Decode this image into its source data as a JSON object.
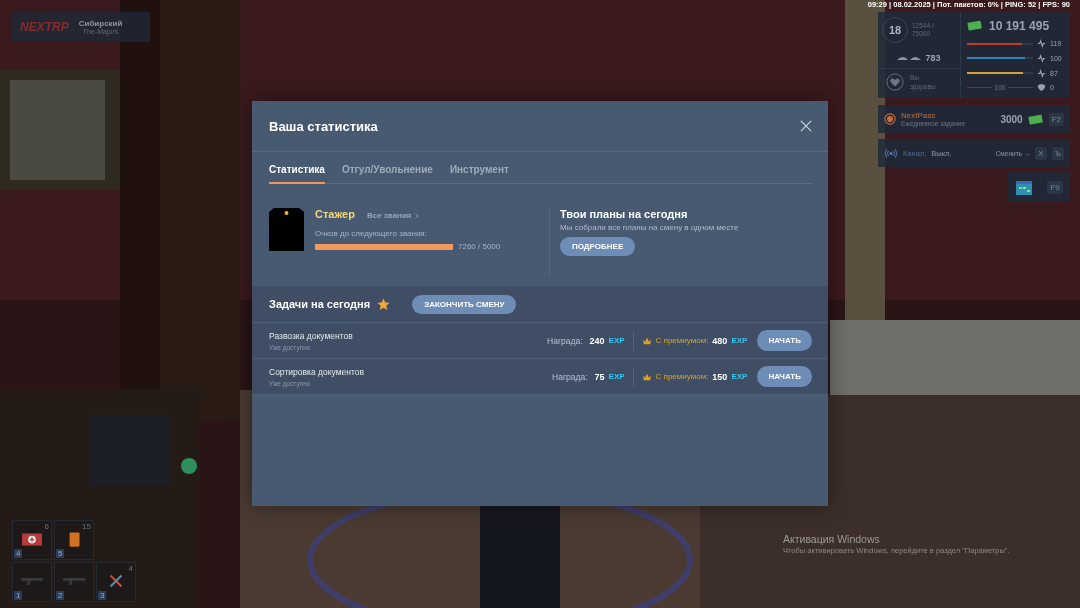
{
  "status_line": "09:29 | 08.02.2025 | Пот. пакетов: 0% | PING: 52 | FPS: 90",
  "server_badge": {
    "logo": "NEXTRP",
    "server": "Сибирский",
    "team": "The-Majors"
  },
  "player_panel": {
    "player_level": "18",
    "xp": "12544 / 75000",
    "money": "10 191 495",
    "reputation": "783",
    "health_status": "Вы здоровы",
    "bars": [
      {
        "kind": "bar",
        "value": "119",
        "color": "#c0392b",
        "level": 0.84
      },
      {
        "kind": "bar",
        "value": "100",
        "color": "#2e86c1",
        "level": 0.88
      },
      {
        "kind": "bar",
        "value": "87",
        "color": "#d4a03a",
        "level": 0.85
      },
      {
        "kind": "split",
        "value": "0",
        "center": "100"
      }
    ]
  },
  "nextpass": {
    "title": "NextPass",
    "subtitle": "Ежедневное задание",
    "reward": "3000",
    "key": "F2"
  },
  "radio": {
    "label": "Канал:",
    "value": "Выкл.",
    "action": "Сменить →",
    "keys": [
      "X",
      "Ъ"
    ]
  },
  "calendar": {
    "key": "F9"
  },
  "modal": {
    "title": "Ваша статистика",
    "tabs": [
      {
        "label": "Статистика",
        "selected": true
      },
      {
        "label": "Отгул/Увольнение",
        "selected": false
      },
      {
        "label": "Инструмент",
        "selected": false
      }
    ],
    "rank": {
      "name": "Стажер",
      "link": "Все звания",
      "progress_label": "Очков до следующего звания:",
      "level": 1,
      "reading": "7260 / 5000"
    },
    "plans": {
      "title": "Твои планы на сегодня",
      "text": "Мы собрали все планы на смену в одном месте",
      "button": "ПОДРОБНЕЕ"
    },
    "tasks": {
      "title": "Задачи на сегодня",
      "finish_button": "ЗАКОНЧИТЬ СМЕНУ",
      "rows": [
        {
          "name": "Развозка документов",
          "status": "Уже доступно",
          "reward_label": "Награда:",
          "reward": "240",
          "reward_unit": "EXP",
          "premium_label": "С премиумом:",
          "premium": "480",
          "premium_unit": "EXP",
          "button": "НАЧАТЬ"
        },
        {
          "name": "Сортировка документов",
          "status": "Уже доступно",
          "reward_label": "Награда:",
          "reward": "75",
          "reward_unit": "EXP",
          "premium_label": "С премиумом:",
          "premium": "150",
          "premium_unit": "EXP",
          "button": "НАЧАТЬ"
        }
      ]
    }
  },
  "hotbar": [
    {
      "key": "4",
      "count": "6",
      "kind": "medkit"
    },
    {
      "key": "5",
      "count": "15",
      "kind": "canister"
    },
    {
      "key": "1",
      "kind": "weapon"
    },
    {
      "key": "2",
      "kind": "weapon"
    },
    {
      "key": "3",
      "count": "4",
      "kind": "tools"
    }
  ],
  "windows_activation": {
    "title": "Активация Windows",
    "text": "Чтобы активировать Windows, перейдите в раздел \"Параметры\"."
  }
}
